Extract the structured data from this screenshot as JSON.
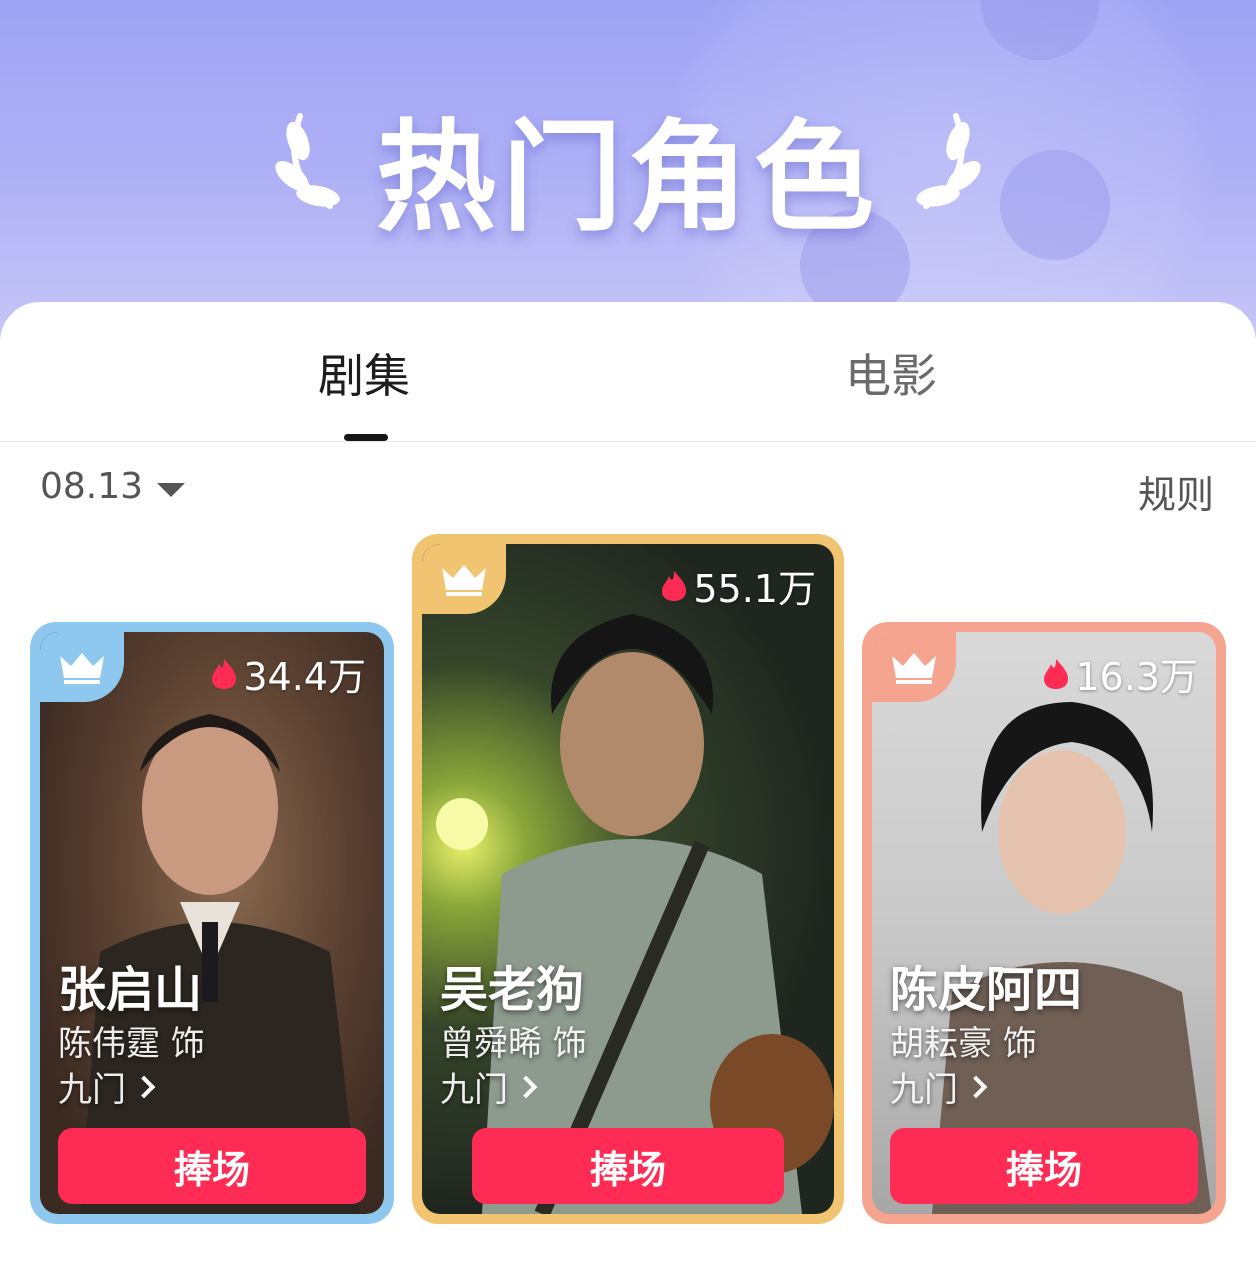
{
  "banner": {
    "title": "热门角色"
  },
  "tabs": [
    {
      "label": "剧集",
      "active": true
    },
    {
      "label": "电影",
      "active": false
    }
  ],
  "filter": {
    "date": "08.13",
    "rules_label": "规则"
  },
  "cards": [
    {
      "rank_color": "#8fc8ef",
      "heat": "34.4万",
      "name": "张启山",
      "actor": "陈伟霆 饰",
      "show": "九门",
      "button": "捧场"
    },
    {
      "rank_color": "#f1c472",
      "heat": "55.1万",
      "name": "吴老狗",
      "actor": "曾舜晞 饰",
      "show": "九门",
      "button": "捧场"
    },
    {
      "rank_color": "#f4a48f",
      "heat": "16.3万",
      "name": "陈皮阿四",
      "actor": "胡耘豪 饰",
      "show": "九门",
      "button": "捧场"
    }
  ],
  "colors": {
    "accent": "#fe2c55",
    "banner": "#a7aaf5"
  }
}
